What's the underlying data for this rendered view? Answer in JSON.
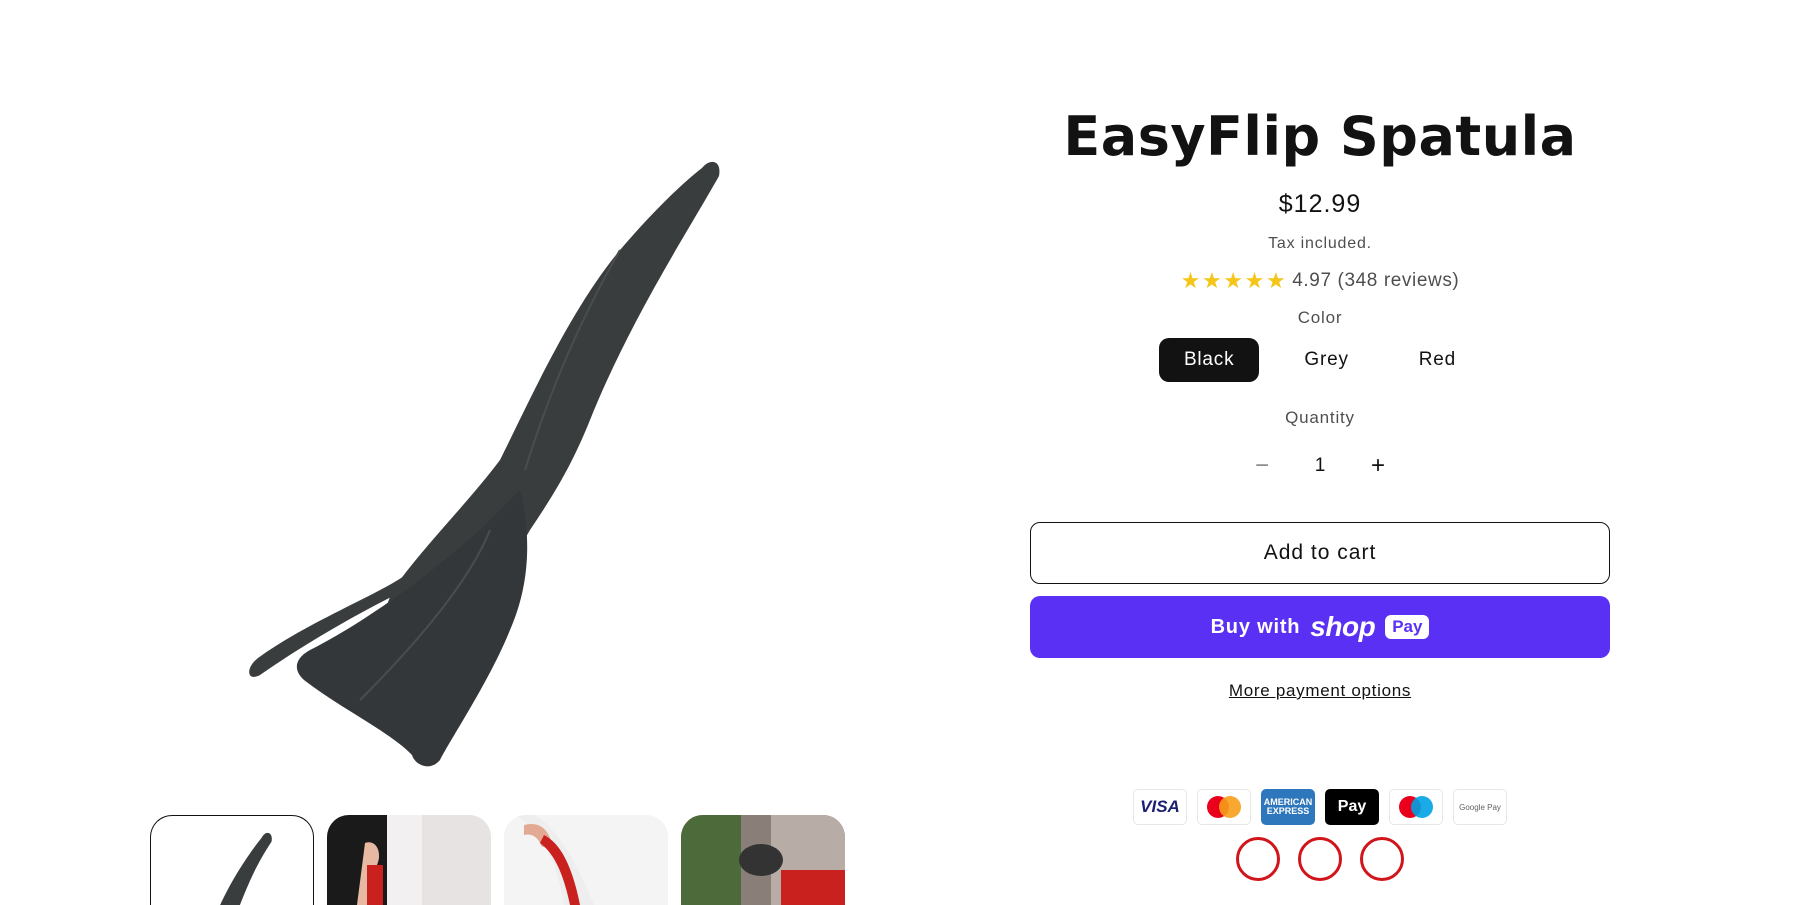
{
  "product": {
    "title": "EasyFlip Spatula",
    "price": "$12.99",
    "tax_note": "Tax included.",
    "rating": {
      "stars": 5,
      "score_text": "4.97 (348 reviews)"
    },
    "color": {
      "label": "Color",
      "options": [
        "Black",
        "Grey",
        "Red"
      ],
      "selected": "Black"
    },
    "quantity": {
      "label": "Quantity",
      "value": "1",
      "decrease_icon": "minus-icon",
      "increase_icon": "plus-icon"
    },
    "add_to_cart_label": "Add to cart",
    "shop_pay": {
      "prefix": "Buy with",
      "brand": "shop",
      "badge": "Pay"
    },
    "more_payment_options": "More payment options"
  },
  "payment_methods": [
    "visa",
    "mastercard",
    "american-express",
    "apple-pay",
    "maestro",
    "google-pay"
  ],
  "payment_labels": {
    "visa": "VISA",
    "amex": "AMERICAN EXPRESS",
    "apple": "Pay",
    "gpay": "Google Pay"
  },
  "gallery": {
    "thumbnail_count": 4,
    "active_index": 0
  },
  "colors": {
    "text": "#121212",
    "shop_pay": "#5a31f4",
    "star": "#f5c518",
    "product_body": "#3a3d3e"
  }
}
